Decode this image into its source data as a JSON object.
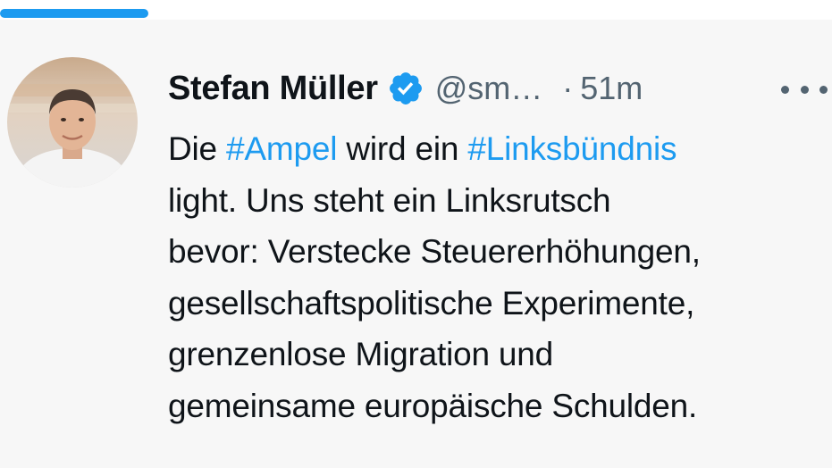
{
  "tweet": {
    "author_name": "Stefan Müller",
    "handle": "@sm…",
    "separator": "·",
    "time": "51m",
    "verified_icon": "verified-badge-icon",
    "more_icon": "more-dots-icon",
    "text": {
      "l1_pre": "Die ",
      "hashtag_1": "#Ampel",
      "l1_mid": " wird ein ",
      "hashtag_2": "#Linksbündnis",
      "l2": "light. Uns steht ein Linksrutsch",
      "l3": "bevor: Verstecke Steuererhöhungen,",
      "l4": "gesellschaftspolitische Experimente,",
      "l5": "grenzenlose Migration und",
      "l6": "gemeinsame europäische Schulden."
    }
  },
  "colors": {
    "accent": "#1d9bf0",
    "text": "#0f1419",
    "secondary": "#536471",
    "background": "#f7f7f7"
  }
}
